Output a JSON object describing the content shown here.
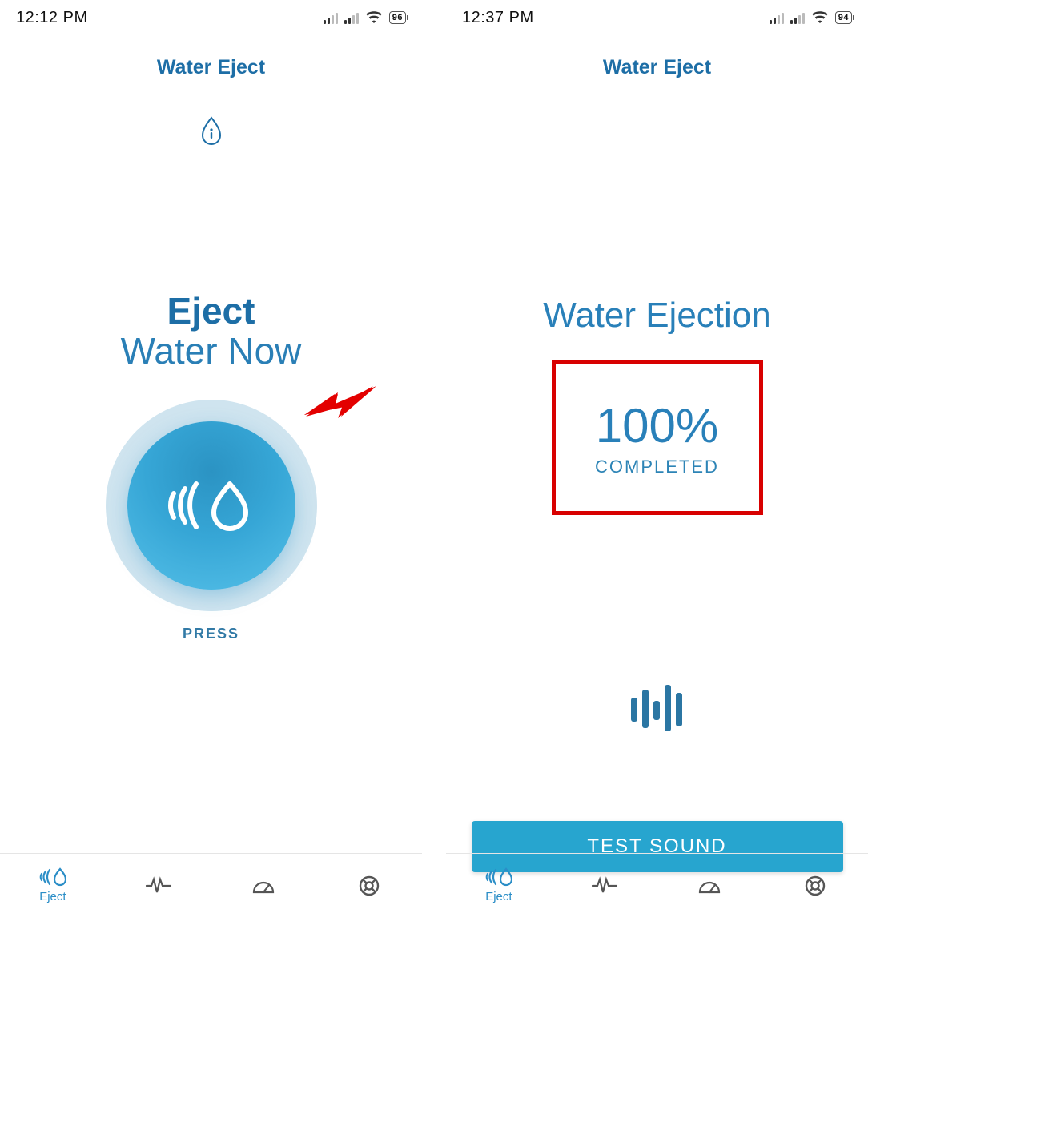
{
  "left": {
    "status": {
      "time": "12:12 PM",
      "battery": "96"
    },
    "header": {
      "title": "Water Eject"
    },
    "main": {
      "line1": "Eject",
      "line2": "Water Now",
      "press": "PRESS"
    },
    "tabs": [
      "Eject"
    ]
  },
  "right": {
    "status": {
      "time": "12:37 PM",
      "battery": "94"
    },
    "header": {
      "title": "Water Eject"
    },
    "heading": "Water Ejection",
    "result": {
      "percent": "100%",
      "label": "COMPLETED"
    },
    "test_btn": "TEST SOUND",
    "tabs": [
      "Eject"
    ]
  },
  "colors": {
    "primary": "#2980b9",
    "accent": "#27a5cf",
    "highlight_box": "#d80000"
  }
}
